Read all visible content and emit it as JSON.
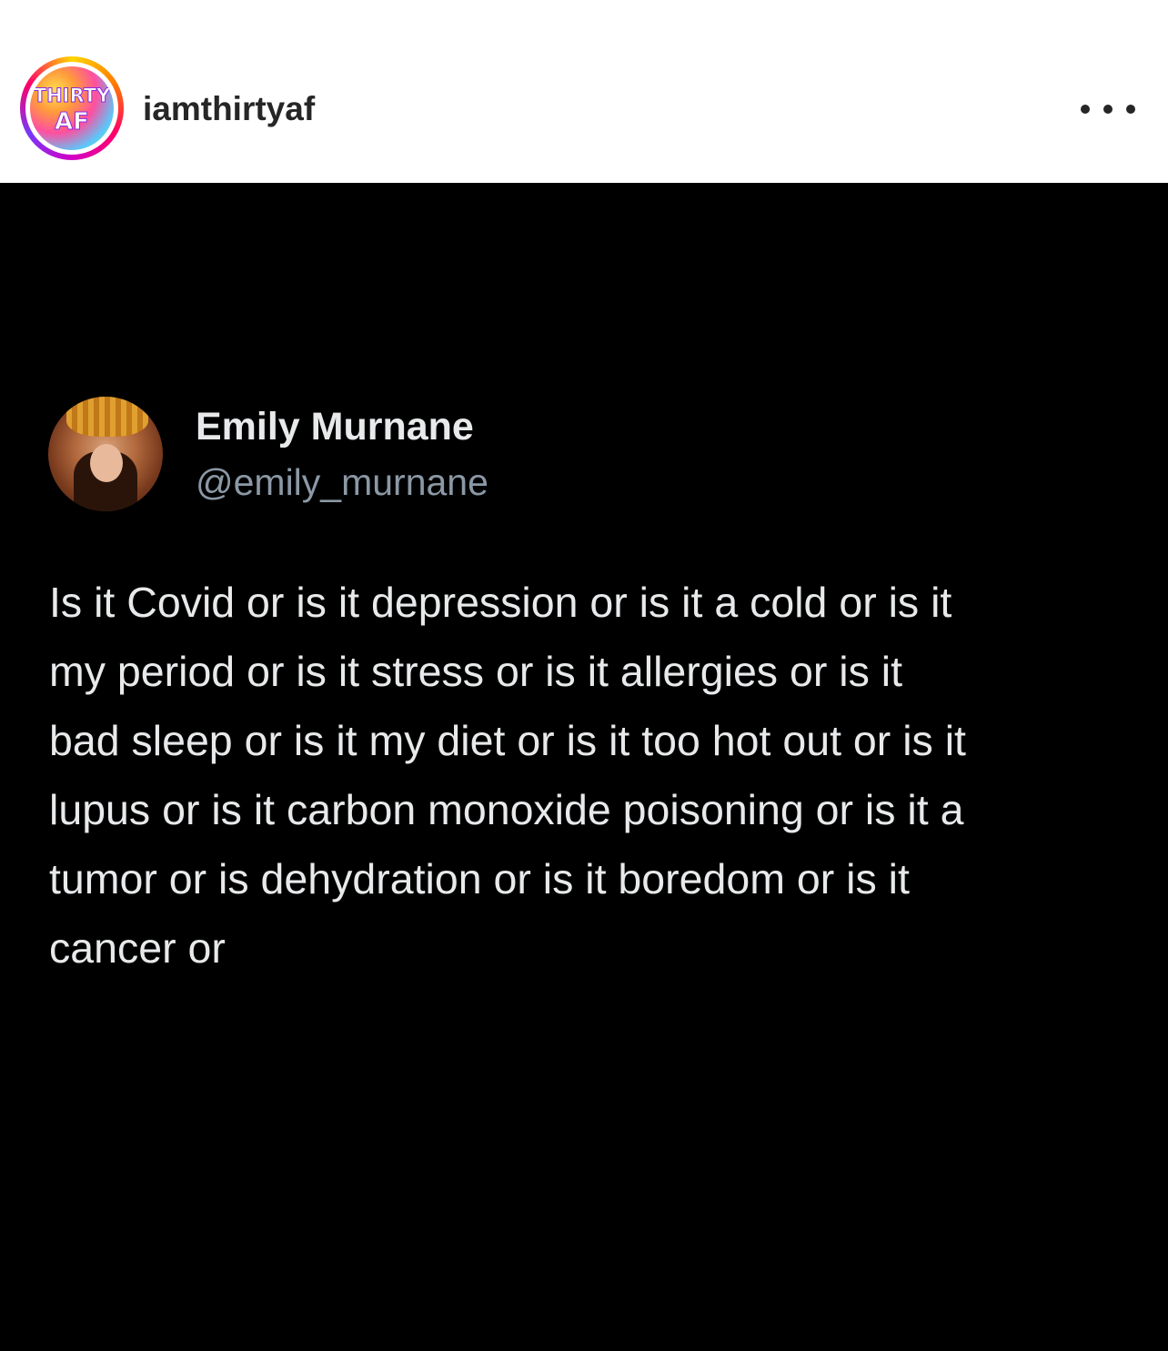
{
  "post_header": {
    "username": "iamthirtyaf",
    "avatar_logo_text_top": "THIRTY",
    "avatar_logo_text_bottom": "AF",
    "more_icon": "more-horizontal-icon"
  },
  "tweet": {
    "display_name": "Emily Murnane",
    "handle": "@emily_murnane",
    "lines": [
      "Is it Covid or is it depression or is it a cold or is it",
      "my period or is it stress or is it allergies or is it",
      "bad sleep or is it my diet or is it too hot out or is it",
      "lupus or is it carbon monoxide poisoning or is it a",
      "tumor or is dehydration or is it boredom or is it",
      "cancer or"
    ]
  },
  "colors": {
    "header_background": "#ffffff",
    "post_background": "#000000",
    "tweet_text": "#e7e9ea",
    "handle_text": "#8b98a5"
  }
}
